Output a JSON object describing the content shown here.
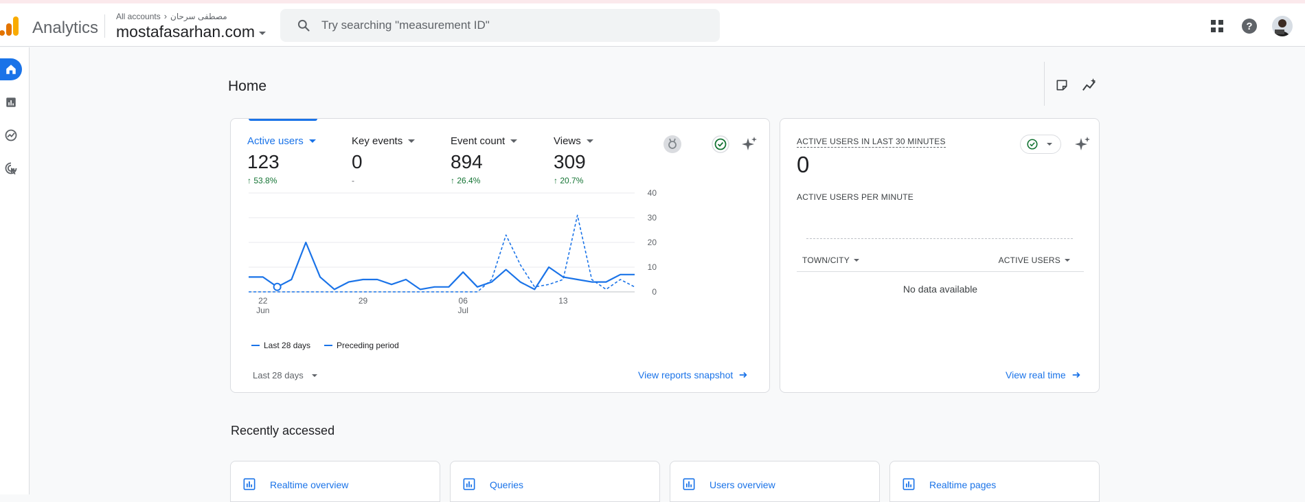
{
  "header": {
    "app_name": "Analytics",
    "account_crumb": "All accounts",
    "account_name": "مصطفى سرحان",
    "property_name": "mostafasarhan.com",
    "search_placeholder": "Try searching \"measurement ID\""
  },
  "page": {
    "title": "Home"
  },
  "overview_card": {
    "metrics": [
      {
        "label": "Active users",
        "value": "123",
        "change": "53.8%",
        "direction": "up",
        "selected": true
      },
      {
        "label": "Key events",
        "value": "0",
        "change": "-",
        "direction": "none",
        "selected": false
      },
      {
        "label": "Event count",
        "value": "894",
        "change": "26.4%",
        "direction": "up",
        "selected": false
      },
      {
        "label": "Views",
        "value": "309",
        "change": "20.7%",
        "direction": "up",
        "selected": false
      }
    ],
    "legend": {
      "current": "Last 28 days",
      "previous": "Preceding period"
    },
    "date_range": "Last 28 days",
    "link": "View reports snapshot"
  },
  "chart_data": {
    "type": "line",
    "x_tick_labels": [
      {
        "day": "22",
        "month": "Jun"
      },
      {
        "day": "29",
        "month": ""
      },
      {
        "day": "06",
        "month": "Jul"
      },
      {
        "day": "13",
        "month": ""
      }
    ],
    "y_ticks": [
      0,
      10,
      20,
      30,
      40
    ],
    "ylim": [
      0,
      40
    ],
    "series": [
      {
        "name": "Last 28 days",
        "style": "solid",
        "values": [
          6,
          6,
          2,
          5,
          20,
          6,
          1,
          4,
          5,
          5,
          3,
          5,
          1,
          2,
          2,
          8,
          2,
          4,
          9,
          4,
          1,
          10,
          6,
          5,
          4,
          4,
          7,
          7
        ]
      },
      {
        "name": "Preceding period",
        "style": "dashed",
        "values": [
          0,
          0,
          0,
          0,
          0,
          0,
          0,
          0,
          0,
          0,
          0,
          0,
          0,
          0,
          0,
          0,
          0,
          5,
          23,
          11,
          2,
          3,
          5,
          31,
          5,
          1,
          5,
          2
        ]
      }
    ],
    "highlight_index": 2,
    "color": "#1a73e8"
  },
  "realtime_card": {
    "title": "ACTIVE USERS IN LAST 30 MINUTES",
    "value": "0",
    "subtitle": "ACTIVE USERS PER MINUTE",
    "col_city": "TOWN/CITY",
    "col_users": "ACTIVE USERS",
    "empty_text": "No data available",
    "link": "View real time"
  },
  "recently_accessed": {
    "title": "Recently accessed",
    "items": [
      "Realtime overview",
      "Queries",
      "Users overview",
      "Realtime pages"
    ]
  },
  "colors": {
    "accent": "#1a73e8",
    "positive": "#137333",
    "logo_orange": "#f9ab00",
    "logo_dark_orange": "#e37400"
  }
}
